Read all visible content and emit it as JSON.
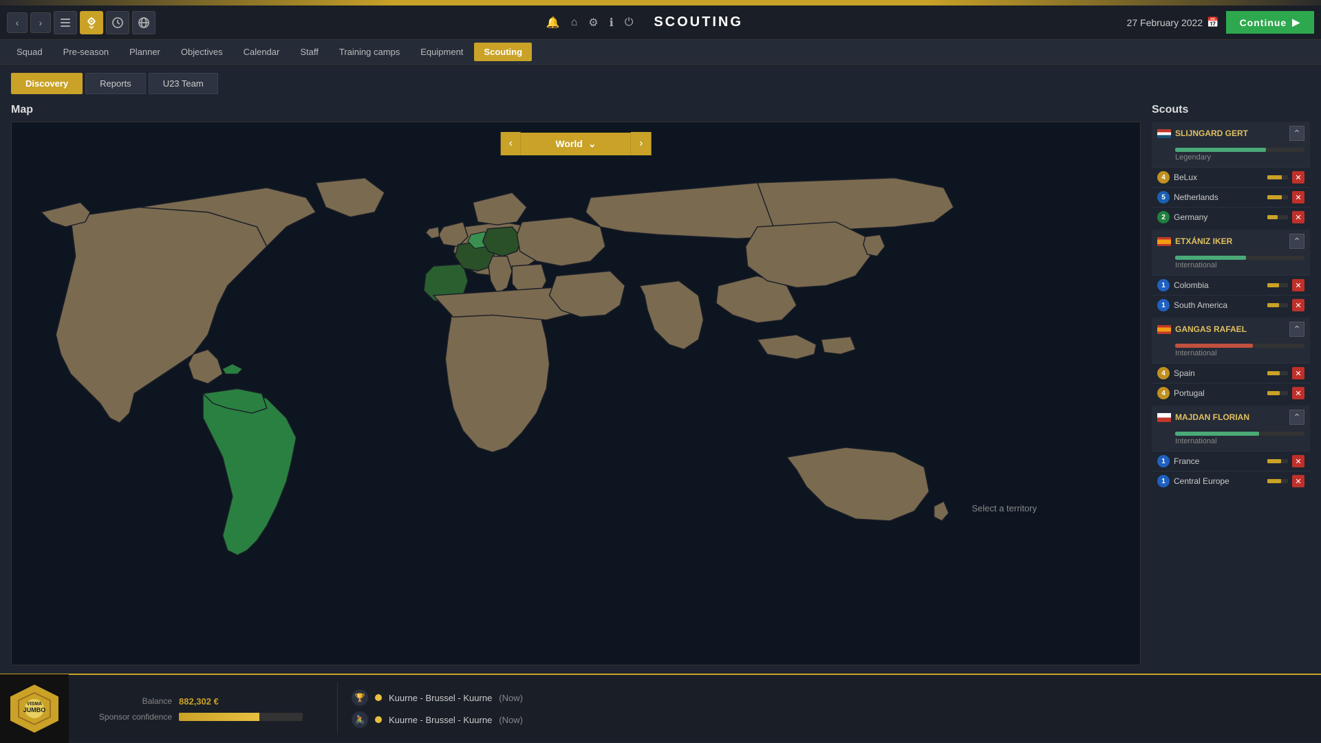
{
  "app": {
    "title": "SCOUTING",
    "date": "27 February 2022",
    "continue_label": "Continue"
  },
  "nav_tabs": [
    {
      "label": "Squad",
      "active": false
    },
    {
      "label": "Pre-season",
      "active": false
    },
    {
      "label": "Planner",
      "active": false
    },
    {
      "label": "Objectives",
      "active": false
    },
    {
      "label": "Calendar",
      "active": false
    },
    {
      "label": "Staff",
      "active": false
    },
    {
      "label": "Training camps",
      "active": false
    },
    {
      "label": "Equipment",
      "active": false
    },
    {
      "label": "Scouting",
      "active": true
    }
  ],
  "sub_tabs": [
    {
      "label": "Discovery",
      "active": true
    },
    {
      "label": "Reports",
      "active": false
    },
    {
      "label": "U23 Team",
      "active": false
    }
  ],
  "map": {
    "section_title": "Map",
    "region_selector": "World",
    "select_territory_text": "Select a territory"
  },
  "scouts": {
    "section_title": "Scouts",
    "items": [
      {
        "id": "slijngard",
        "name": "SLIJNGARD GERT",
        "flag": "nl",
        "skill_pct": 70,
        "level": "Legendary",
        "collapsed": false,
        "assignments": [
          {
            "number": 4,
            "num_color": "yellow",
            "region": "BeLux"
          },
          {
            "number": 5,
            "num_color": "blue",
            "region": "Netherlands"
          },
          {
            "number": 2,
            "num_color": "green",
            "region": "Germany"
          }
        ]
      },
      {
        "id": "etxaniz",
        "name": "ETXÁNIZ IKER",
        "flag": "es",
        "skill_pct": 55,
        "level": "International",
        "collapsed": false,
        "assignments": [
          {
            "number": 1,
            "num_color": "blue",
            "region": "Colombia"
          },
          {
            "number": 1,
            "num_color": "blue",
            "region": "South America"
          }
        ]
      },
      {
        "id": "gangas",
        "name": "GANGAS RAFAEL",
        "flag": "es",
        "skill_pct": 60,
        "level": "International",
        "collapsed": false,
        "assignments": [
          {
            "number": 4,
            "num_color": "yellow",
            "region": "Spain"
          },
          {
            "number": 4,
            "num_color": "yellow",
            "region": "Portugal"
          }
        ]
      },
      {
        "id": "majdan",
        "name": "MAJDAN FLORIAN",
        "flag": "pl",
        "skill_pct": 65,
        "level": "International",
        "collapsed": false,
        "assignments": [
          {
            "number": 1,
            "num_color": "blue",
            "region": "France"
          },
          {
            "number": 1,
            "num_color": "blue",
            "region": "Central Europe"
          }
        ]
      }
    ]
  },
  "bottom": {
    "balance_label": "Balance",
    "balance_value": "882,302 €",
    "sponsor_label": "Sponsor confidence",
    "sponsor_pct": 65,
    "races": [
      {
        "icon": "trophy",
        "dot_color": "#e8c040",
        "name": "Kuurne - Brussel - Kuurne",
        "time": "(Now)"
      },
      {
        "icon": "cycle",
        "dot_color": "#e8c040",
        "name": "Kuurne - Brussel - Kuurne",
        "time": "(Now)"
      }
    ]
  }
}
